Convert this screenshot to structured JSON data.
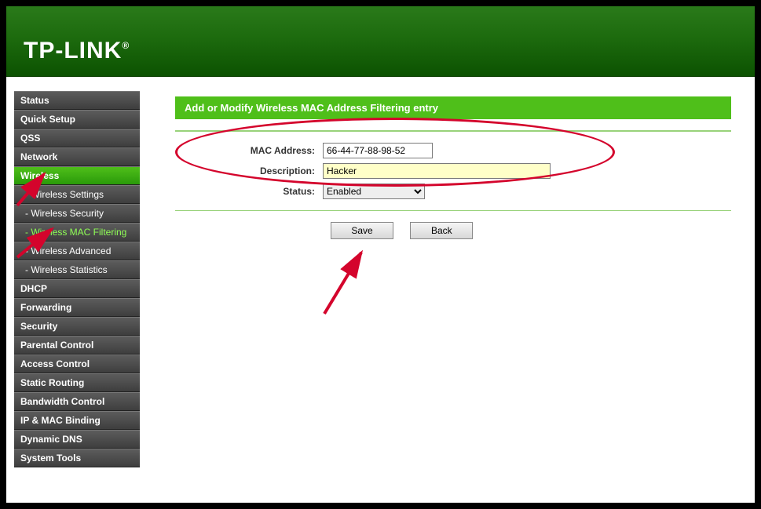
{
  "brand": "TP-LINK",
  "sidebar": {
    "items": [
      {
        "label": "Status",
        "type": "top"
      },
      {
        "label": "Quick Setup",
        "type": "top"
      },
      {
        "label": "QSS",
        "type": "top"
      },
      {
        "label": "Network",
        "type": "top"
      },
      {
        "label": "Wireless",
        "type": "top",
        "active": true
      },
      {
        "label": "- Wireless Settings",
        "type": "sub"
      },
      {
        "label": "- Wireless Security",
        "type": "sub"
      },
      {
        "label": "- Wireless MAC Filtering",
        "type": "sub",
        "active_sub": true
      },
      {
        "label": "- Wireless Advanced",
        "type": "sub"
      },
      {
        "label": "- Wireless Statistics",
        "type": "sub"
      },
      {
        "label": "DHCP",
        "type": "top"
      },
      {
        "label": "Forwarding",
        "type": "top"
      },
      {
        "label": "Security",
        "type": "top"
      },
      {
        "label": "Parental Control",
        "type": "top"
      },
      {
        "label": "Access Control",
        "type": "top"
      },
      {
        "label": "Static Routing",
        "type": "top"
      },
      {
        "label": "Bandwidth Control",
        "type": "top"
      },
      {
        "label": "IP & MAC Binding",
        "type": "top"
      },
      {
        "label": "Dynamic DNS",
        "type": "top"
      },
      {
        "label": "System Tools",
        "type": "top"
      }
    ]
  },
  "page": {
    "title": "Add or Modify Wireless MAC Address Filtering entry",
    "labels": {
      "mac": "MAC Address:",
      "desc": "Description:",
      "status": "Status:"
    },
    "values": {
      "mac": "66-44-77-88-98-52",
      "desc": "Hacker",
      "status": "Enabled"
    },
    "buttons": {
      "save": "Save",
      "back": "Back"
    }
  }
}
